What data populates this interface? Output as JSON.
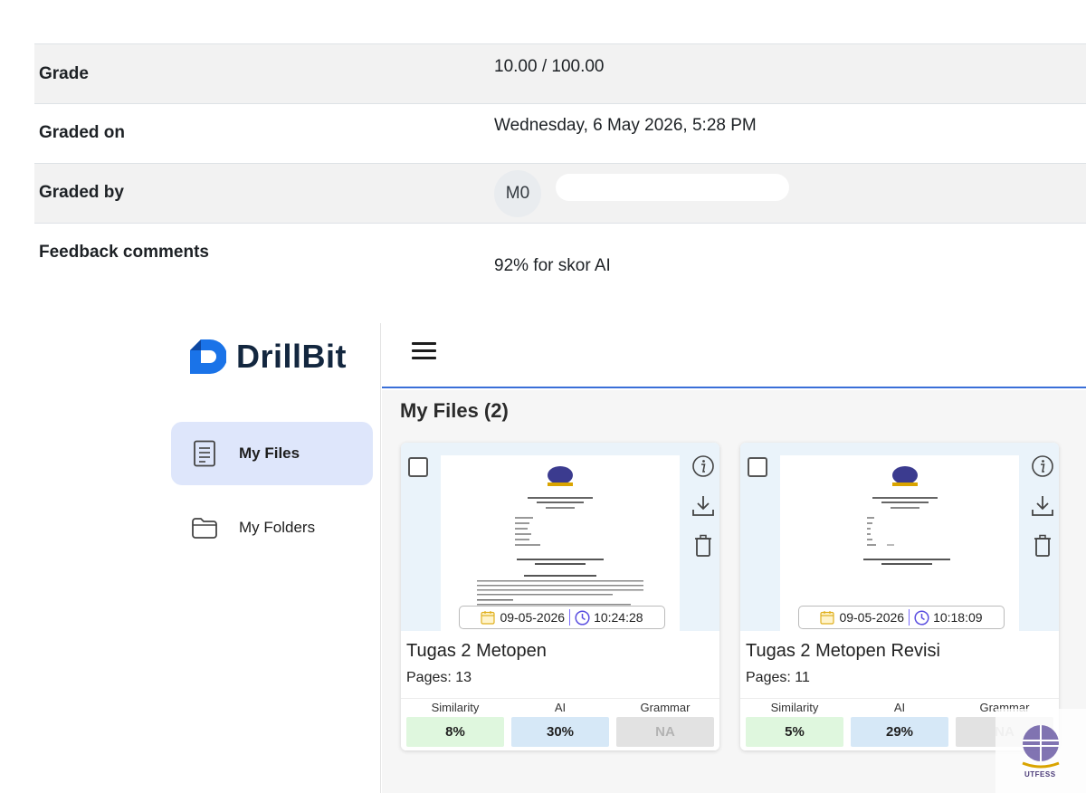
{
  "grading": {
    "grade_label": "Grade",
    "grade_value": "10.00 / 100.00",
    "graded_on_label": "Graded on",
    "graded_on_value": "Wednesday, 6 May 2026, 5:28 PM",
    "graded_by_label": "Graded by",
    "grader_initials": "M0",
    "feedback_label": "Feedback comments",
    "feedback_value": "92% for skor AI"
  },
  "app": {
    "brand": "DrillBit",
    "brand_color": "#1a73e8",
    "sidebar": {
      "items": [
        {
          "label": "My Files",
          "icon": "document-icon",
          "active": true
        },
        {
          "label": "My Folders",
          "icon": "folder-icon",
          "active": false
        }
      ]
    },
    "topbar": {
      "menu_icon": "hamburger-icon"
    },
    "main_title": "My Files (2)",
    "files": [
      {
        "name": "Tugas 2 Metopen",
        "pages": "Pages: 13",
        "date": "09-05-2026",
        "time": "10:24:28",
        "metrics": [
          {
            "label": "Similarity",
            "value": "8%"
          },
          {
            "label": "AI",
            "value": "30%"
          },
          {
            "label": "Grammar",
            "value": "NA"
          }
        ]
      },
      {
        "name": "Tugas 2 Metopen Revisi",
        "pages": "Pages: 11",
        "date": "09-05-2026",
        "time": "10:18:09",
        "metrics": [
          {
            "label": "Similarity",
            "value": "5%"
          },
          {
            "label": "AI",
            "value": "29%"
          },
          {
            "label": "Grammar",
            "value": "NA"
          }
        ]
      }
    ],
    "colors": {
      "similarity_bg": "#dff7de",
      "ai_bg": "#d6e8f7",
      "grammar_bg": "#e2e2e2",
      "active_nav_bg": "#dee6fb",
      "topbar_accent": "#3a6fd8"
    }
  },
  "watermark": {
    "text": "UTFESS"
  }
}
